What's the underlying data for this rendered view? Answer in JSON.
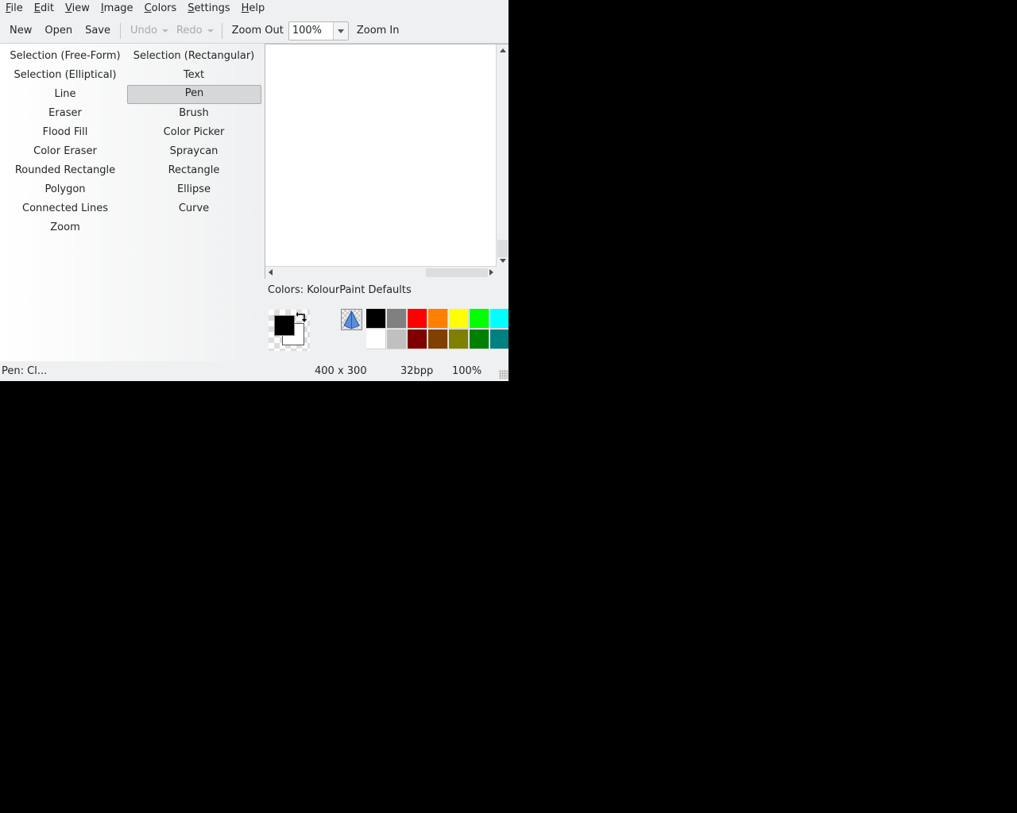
{
  "menubar": {
    "items": [
      {
        "acc": "F",
        "rest": "ile"
      },
      {
        "acc": "E",
        "rest": "dit"
      },
      {
        "acc": "V",
        "rest": "iew"
      },
      {
        "acc": "I",
        "rest": "mage"
      },
      {
        "acc": "C",
        "rest": "olors"
      },
      {
        "acc": "S",
        "rest": "ettings"
      },
      {
        "acc": "H",
        "rest": "elp"
      }
    ]
  },
  "toolbar": {
    "new": "New",
    "open": "Open",
    "save": "Save",
    "undo": "Undo",
    "redo": "Redo",
    "zoom_out": "Zoom Out",
    "zoom_value": "100%",
    "zoom_in": "Zoom In"
  },
  "tools": {
    "selected": "Pen",
    "left": [
      "Selection (Free-Form)",
      "Selection (Elliptical)",
      "Line",
      "Eraser",
      "Flood Fill",
      "Color Eraser",
      "Rounded Rectangle",
      "Polygon",
      "Connected Lines",
      "Zoom"
    ],
    "right": [
      "Selection (Rectangular)",
      "Text",
      "Pen",
      "Brush",
      "Color Picker",
      "Spraycan",
      "Rectangle",
      "Ellipse",
      "Curve"
    ]
  },
  "colors": {
    "label": "Colors: KolourPaint Defaults",
    "foreground": "#000000",
    "background": "#ffffff",
    "palette_top": [
      "#000000",
      "#808080",
      "#ff0000",
      "#ff8000",
      "#ffff00",
      "#00ff00",
      "#00ffff"
    ],
    "palette_bottom": [
      "#ffffff",
      "#c0c0c0",
      "#800000",
      "#804000",
      "#808000",
      "#008000",
      "#008080"
    ]
  },
  "status": {
    "message": "Pen: Cl...",
    "dimensions": "400 x 300",
    "depth": "32bpp",
    "zoom": "100%"
  }
}
